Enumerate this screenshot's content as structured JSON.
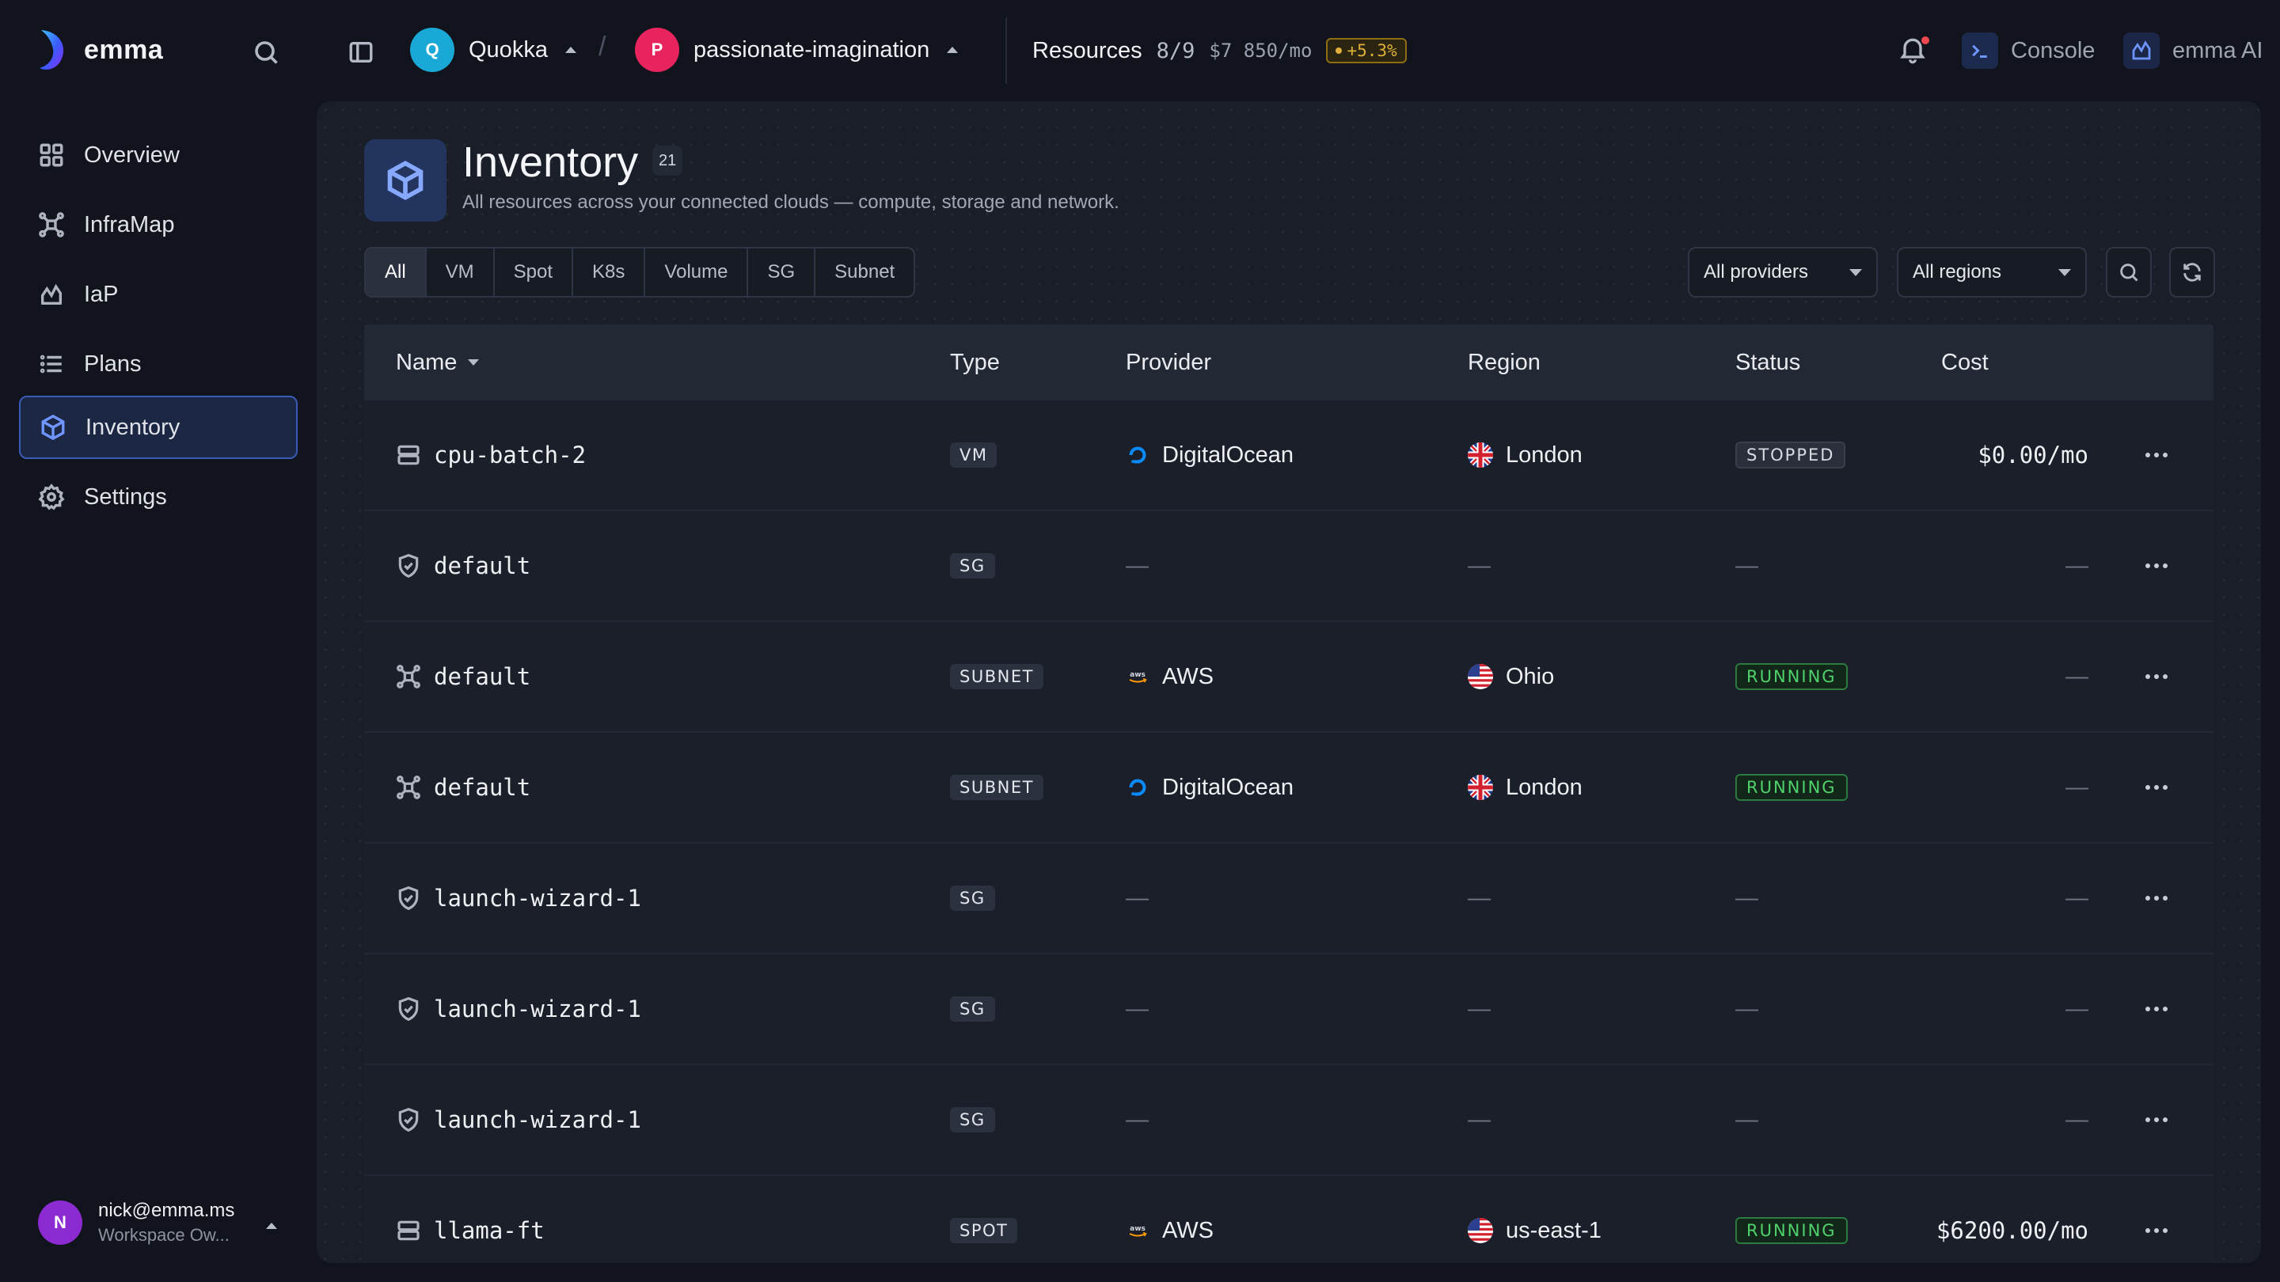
{
  "app": {
    "name": "emma"
  },
  "topbar": {
    "org": {
      "initial": "Q",
      "name": "Quokka",
      "color": "#1aa9d6"
    },
    "project": {
      "initial": "P",
      "name": "passionate-imagination",
      "color": "#e8245e"
    },
    "resources": {
      "label": "Resources",
      "count": "8/9",
      "cost": "$7 850/mo",
      "change": "+5.3%"
    },
    "console_label": "Console",
    "ai_label": "emma AI"
  },
  "sidebar": {
    "items": [
      {
        "label": "Overview",
        "icon": "grid-icon"
      },
      {
        "label": "InfraMap",
        "icon": "network-icon"
      },
      {
        "label": "IaP",
        "icon": "chart-icon"
      },
      {
        "label": "Plans",
        "icon": "list-icon"
      },
      {
        "label": "Inventory",
        "icon": "cube-icon",
        "active": true
      },
      {
        "label": "Settings",
        "icon": "gear-icon"
      }
    ],
    "user": {
      "initial": "N",
      "email": "nick@emma.ms",
      "role": "Workspace Ow..."
    }
  },
  "page": {
    "title": "Inventory",
    "count": "21",
    "subtitle": "All resources across your connected clouds — compute, storage and network."
  },
  "filters": {
    "tabs": [
      "All",
      "VM",
      "Spot",
      "K8s",
      "Volume",
      "SG",
      "Subnet"
    ],
    "active_tab": "All",
    "providers": "All providers",
    "regions": "All regions"
  },
  "table": {
    "columns": {
      "name": "Name",
      "type": "Type",
      "provider": "Provider",
      "region": "Region",
      "status": "Status",
      "cost": "Cost"
    },
    "rows": [
      {
        "icon": "server-icon",
        "name": "cpu-batch-2",
        "type": "VM",
        "provider": "DigitalOcean",
        "provider_icon": "digitalocean-icon",
        "region": "London",
        "flag": "uk",
        "status": "STOPPED",
        "cost": "$0.00/mo"
      },
      {
        "icon": "shield-icon",
        "name": "default",
        "type": "SG",
        "provider": "—",
        "region": "—",
        "status": "—",
        "cost": "—"
      },
      {
        "icon": "network-icon",
        "name": "default",
        "type": "SUBNET",
        "provider": "AWS",
        "provider_icon": "aws-icon",
        "region": "Ohio",
        "flag": "us",
        "status": "RUNNING",
        "cost": "—"
      },
      {
        "icon": "network-icon",
        "name": "default",
        "type": "SUBNET",
        "provider": "DigitalOcean",
        "provider_icon": "digitalocean-icon",
        "region": "London",
        "flag": "uk",
        "status": "RUNNING",
        "cost": "—"
      },
      {
        "icon": "shield-icon",
        "name": "launch-wizard-1",
        "type": "SG",
        "provider": "—",
        "region": "—",
        "status": "—",
        "cost": "—"
      },
      {
        "icon": "shield-icon",
        "name": "launch-wizard-1",
        "type": "SG",
        "provider": "—",
        "region": "—",
        "status": "—",
        "cost": "—"
      },
      {
        "icon": "shield-icon",
        "name": "launch-wizard-1",
        "type": "SG",
        "provider": "—",
        "region": "—",
        "status": "—",
        "cost": "—"
      },
      {
        "icon": "server-icon",
        "name": "llama-ft",
        "type": "SPOT",
        "provider": "AWS",
        "provider_icon": "aws-icon",
        "region": "us-east-1",
        "flag": "us",
        "status": "RUNNING",
        "cost": "$6200.00/mo"
      }
    ]
  }
}
